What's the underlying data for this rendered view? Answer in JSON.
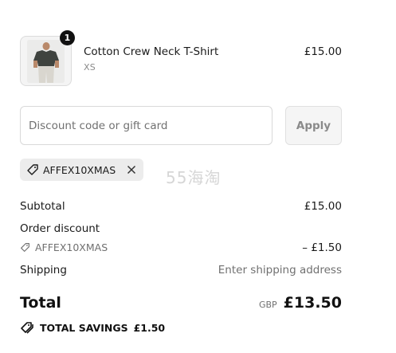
{
  "product": {
    "name": "Cotton Crew Neck T-Shirt",
    "variant": "XS",
    "price": "£15.00",
    "quantity": "1"
  },
  "discount": {
    "placeholder": "Discount code or gift card",
    "value": "",
    "apply_label": "Apply",
    "applied_code": "AFFEX10XMAS"
  },
  "watermark": "55海淘",
  "summary": {
    "subtotal_label": "Subtotal",
    "subtotal_value": "£15.00",
    "order_discount_label": "Order discount",
    "discount_code": "AFFEX10XMAS",
    "discount_value": "– £1.50",
    "shipping_label": "Shipping",
    "shipping_value": "Enter shipping address",
    "total_label": "Total",
    "currency": "GBP",
    "total_value": "£13.50",
    "savings_label": "TOTAL SAVINGS",
    "savings_value": "£1.50"
  },
  "icons": {
    "tag": "tag-icon",
    "close": "close-icon",
    "savings": "tags-icon"
  }
}
